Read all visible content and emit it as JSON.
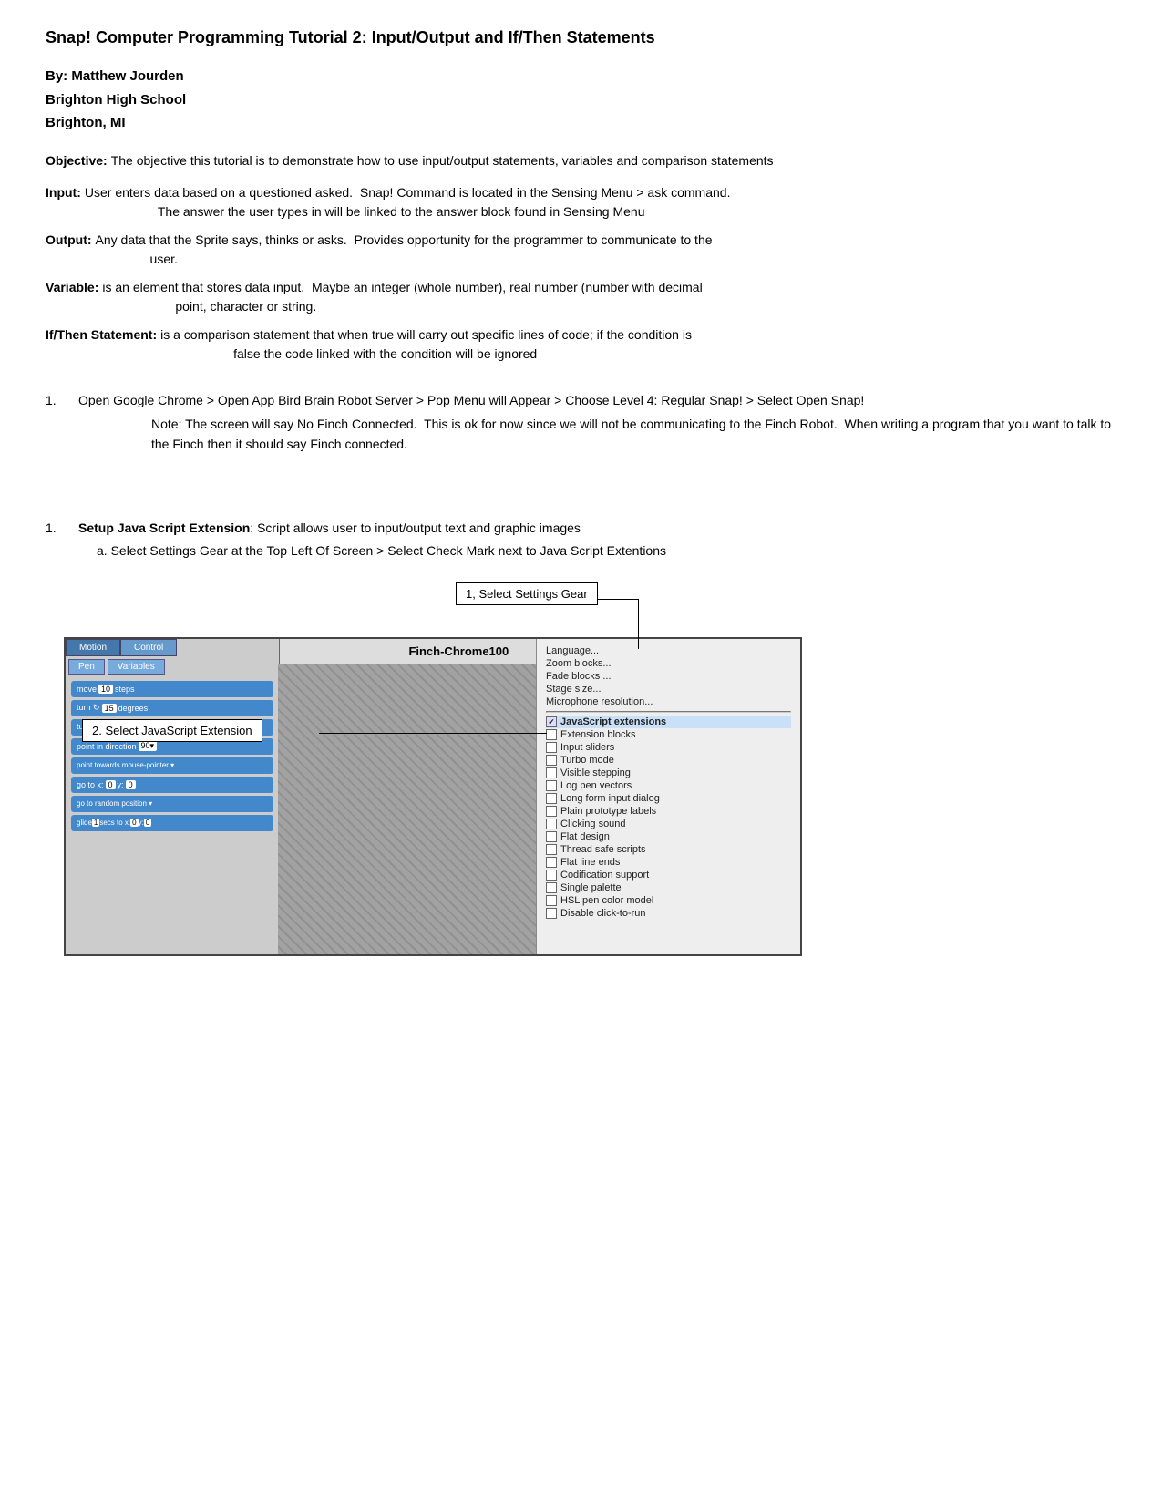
{
  "page": {
    "title": "Snap! Computer Programming Tutorial 2: Input/Output and If/Then Statements",
    "author": {
      "name": "By: Matthew Jourden",
      "school": "Brighton High School",
      "location": "Brighton, MI"
    },
    "objective_label": "Objective:",
    "objective_text": "The objective this tutorial is to demonstrate how to use input/output statements, variables and comparison statements",
    "definitions": [
      {
        "label": "Input:",
        "text": "User enters data based on a questioned asked.  Snap! Command is located in the Sensing Menu > ask command.",
        "indent": "The answer the user types in will be linked to the answer block found in Sensing Menu"
      },
      {
        "label": "Output:",
        "text": "Any data that the Sprite says, thinks or asks.  Provides opportunity for the programmer to communicate to the user."
      },
      {
        "label": "Variable:",
        "text": "is an element that stores data input.  Maybe an integer (whole number), real number (number with decimal point, character or string."
      },
      {
        "label": "If/Then Statement:",
        "text": "is a comparison statement that when true will carry out specific lines of code; if the condition is false the code linked with the condition will be ignored"
      }
    ],
    "steps": [
      {
        "num": "1.",
        "text": "Open Google Chrome > Open App Bird Brain Robot Server > Pop Menu will Appear > Choose Level 4: Regular Snap! > Select Open Snap!",
        "note": "Note: The screen will say No Finch Connected.  This is ok for now since we will not be communicating to the Finch Robot.  When writing a program that you want to talk to the Finch then it should say Finch connected."
      }
    ],
    "setup_section": {
      "num": "1.",
      "title": "Setup Java Script Extension",
      "title_colon": ":",
      "subtitle": " Script allows user to input/output text and graphic images",
      "substep": "a. Select Settings Gear at the Top Left Of Screen > Select Check Mark next to Java Script Extentions"
    },
    "screenshot": {
      "callout1": "1, Select Settings Gear",
      "callout2": "2. Select JavaScript Extension",
      "snap_title": "Finch-Chrome100",
      "menu_items": [
        {
          "label": "Language...",
          "checked": false
        },
        {
          "label": "Zoom blocks...",
          "checked": false
        },
        {
          "label": "Fade blocks ...",
          "checked": false
        },
        {
          "label": "Stage size...",
          "checked": false
        },
        {
          "label": "Microphone resolution...",
          "checked": false
        },
        {
          "label": "JavaScript extensions",
          "checked": true,
          "highlighted": true
        },
        {
          "label": "Extension blocks",
          "checked": false
        },
        {
          "label": "Input sliders",
          "checked": false
        },
        {
          "label": "Turbo mode",
          "checked": false
        },
        {
          "label": "Visible stepping",
          "checked": false
        },
        {
          "label": "Log pen vectors",
          "checked": false
        },
        {
          "label": "Long form input dialog",
          "checked": false
        },
        {
          "label": "Plain prototype labels",
          "checked": false
        },
        {
          "label": "Clicking sound",
          "checked": false
        },
        {
          "label": "Flat design",
          "checked": false
        },
        {
          "label": "Thread safe scripts",
          "checked": false
        },
        {
          "label": "Flat line ends",
          "checked": false
        },
        {
          "label": "Codification support",
          "checked": false
        },
        {
          "label": "Single palette",
          "checked": false
        },
        {
          "label": "HSL pen color model",
          "checked": false
        },
        {
          "label": "Disable click-to-run",
          "checked": false
        }
      ],
      "tabs": [
        "Motion",
        "Control"
      ],
      "subtabs": [
        "Pen",
        "Variables"
      ],
      "blocks": [
        "move 10 steps",
        "turn ↻ 15 degrees",
        "turn ↺ 15 degrees",
        "point in direction 90▾",
        "point towards mouse-pointer ▾",
        "go to x: 0 y: 0",
        "go to random position ▾",
        "glide 1 secs to x: 0 y: 0"
      ]
    }
  }
}
